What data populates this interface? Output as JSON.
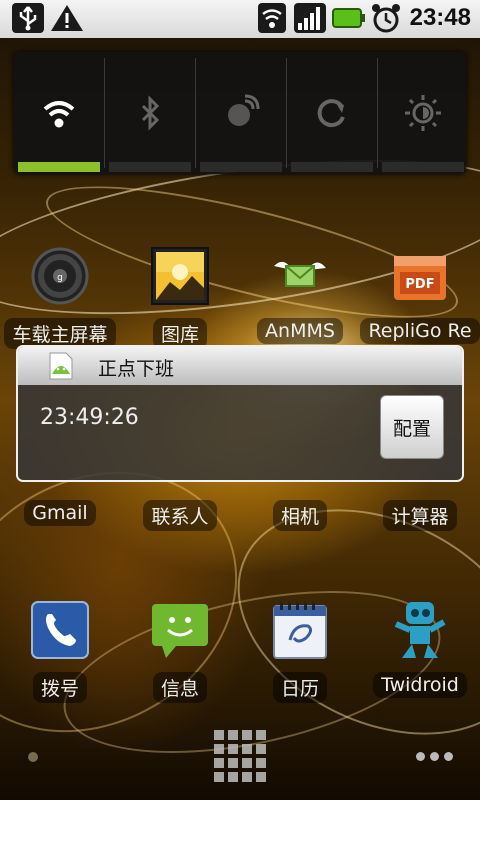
{
  "status": {
    "time": "23:48"
  },
  "row1": [
    {
      "label": "车载主屏幕",
      "icon": "steering-wheel-icon"
    },
    {
      "label": "图库",
      "icon": "gallery-icon"
    },
    {
      "label": "AnMMS",
      "icon": "winged-envelope-icon"
    },
    {
      "label": "RepliGo Re",
      "icon": "pdf-icon"
    }
  ],
  "row2": [
    {
      "label": "Gmail"
    },
    {
      "label": "联系人"
    },
    {
      "label": "相机"
    },
    {
      "label": "计算器"
    }
  ],
  "row3": [
    {
      "label": "拨号",
      "icon": "phone-icon"
    },
    {
      "label": "信息",
      "icon": "message-icon"
    },
    {
      "label": "日历",
      "icon": "calendar-icon"
    },
    {
      "label": "Twidroid",
      "icon": "robot-icon"
    }
  ],
  "widget": {
    "title": "正点下班",
    "clock": "23:49:26",
    "config_label": "配置"
  },
  "colors": {
    "power_on": "#8cbf2a",
    "widget_border": "#f0f0f0"
  }
}
